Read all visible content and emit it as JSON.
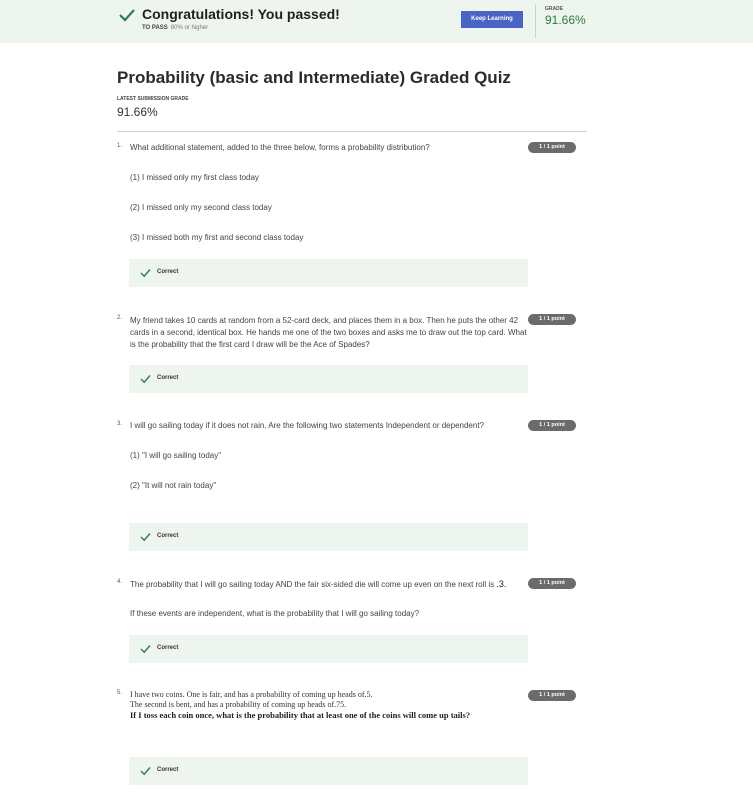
{
  "banner": {
    "title": "Congratulations! You passed!",
    "to_pass_label": "TO PASS",
    "to_pass_requirement": "80% or higher",
    "button_label": "Keep Learning",
    "grade_label": "GRADE",
    "grade_value": "91.66%"
  },
  "quiz": {
    "title": "Probability (basic and Intermediate) Graded Quiz",
    "latest_label": "LATEST SUBMISSION GRADE",
    "latest_value": "91.66%"
  },
  "questions": [
    {
      "number": "1.",
      "text": "What additional statement, added to the three below, forms a probability distribution?",
      "options": [
        "(1) I missed only my first class today",
        "(2) I missed only my second class today",
        "(3) I missed both my first and second class today"
      ],
      "points": "1 / 1 point",
      "feedback": "Correct"
    },
    {
      "number": "2.",
      "text": "My friend takes 10 cards at random from a 52-card deck, and places them in a box. Then he puts the other 42 cards in a second, identical box. He hands me one of the two boxes and asks me to draw out the top card. What is the probability that the first card I draw will be the Ace of Spades?",
      "points": "1 / 1 point",
      "feedback": "Correct"
    },
    {
      "number": "3.",
      "text": "I will go sailing today if it does not rain. Are the following two statements Independent or dependent?",
      "options": [
        "(1) \"I will go sailing today\"",
        "(2) \"It will not rain today\""
      ],
      "points": "1 / 1 point",
      "feedback": "Correct"
    },
    {
      "number": "4.",
      "text_before": "The probability that I will go sailing today AND the fair six-sided die will come up even on the next roll is",
      "text_value": ".3.",
      "followup": "If these events are independent, what is the probability that I will go sailing today?",
      "points": "1 / 1 point",
      "feedback": "Correct"
    },
    {
      "number": "5.",
      "line1": "I have two coins. One is fair, and has a probability of coming up heads of.5.",
      "line2": "The second is bent, and has a probability of coming up heads of.75.",
      "line3": "If I toss each coin once, what is the probability that at least one of the coins will come up tails?",
      "points": "1 / 1 point",
      "feedback": "Correct"
    }
  ],
  "colors": {
    "banner_bg": "#eef4ee",
    "button": "#4a64c4",
    "grade_green": "#2a7a3e",
    "badge": "#6b6b6b",
    "check": "#2e7d4a"
  }
}
